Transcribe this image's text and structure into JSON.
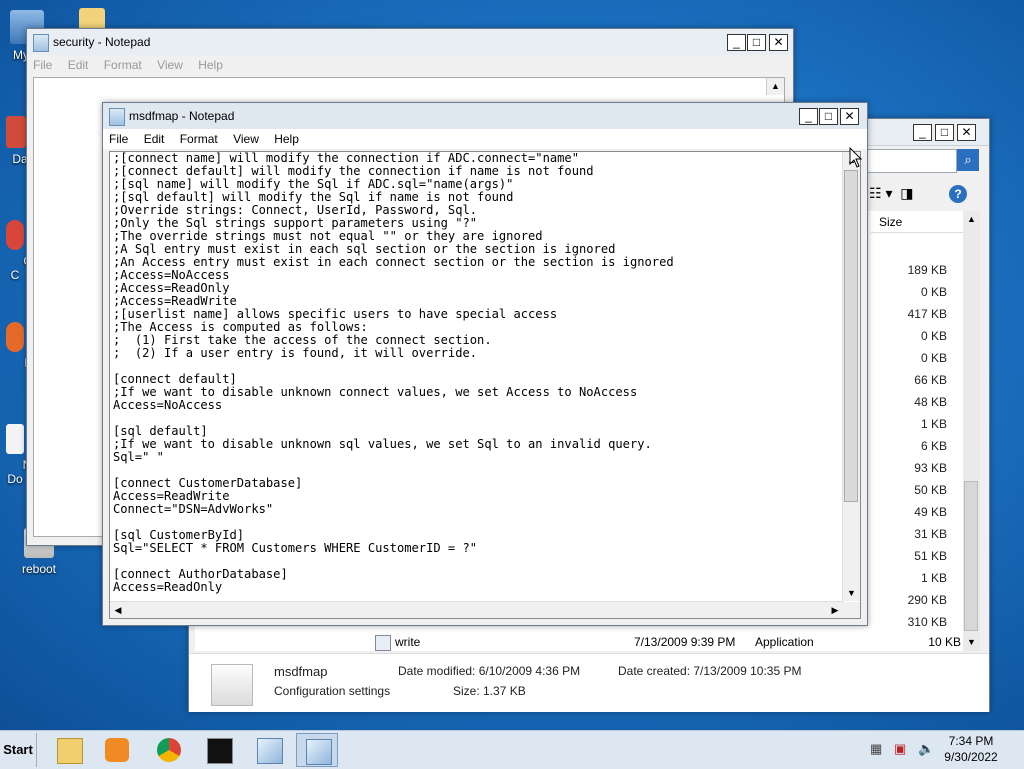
{
  "desktop": {
    "icons": [
      {
        "label": "My C",
        "name": "my-computer"
      },
      {
        "label": "Data",
        "name": "data-shortcut"
      },
      {
        "label": "G\nC",
        "name": "chrome-shortcut"
      },
      {
        "label": "F",
        "name": "firefox-shortcut"
      },
      {
        "label": "N\nDo",
        "name": "new-document"
      },
      {
        "label": "reboot",
        "name": "reboot"
      }
    ]
  },
  "security_window": {
    "title": "security - Notepad",
    "menu": [
      "File",
      "Edit",
      "Format",
      "View",
      "Help"
    ]
  },
  "explorer_window": {
    "column_size": "Size",
    "sizes": [
      "189 KB",
      "0 KB",
      "417 KB",
      "0 KB",
      "0 KB",
      "66 KB",
      "48 KB",
      "1 KB",
      "6 KB",
      "93 KB",
      "50 KB",
      "49 KB",
      "31 KB",
      "51 KB",
      "1 KB",
      "290 KB",
      "310 KB",
      "10 KB"
    ],
    "row_write": {
      "name": "write",
      "modified": "7/13/2009 9:39 PM",
      "type": "Application",
      "size": "10 KB"
    },
    "details": {
      "name": "msdfmap",
      "type": "Configuration settings",
      "modified": "Date modified: 6/10/2009 4:36 PM",
      "created": "Date created: 7/13/2009 10:35 PM",
      "size": "Size: 1.37 KB"
    }
  },
  "notepad": {
    "title": "msdfmap - Notepad",
    "menu": [
      "File",
      "Edit",
      "Format",
      "View",
      "Help"
    ],
    "lines": [
      ";[connect name] will modify the connection if ADC.connect=\"name\"",
      ";[connect default] will modify the connection if name is not found",
      ";[sql name] will modify the Sql if ADC.sql=\"name(args)\"",
      ";[sql default] will modify the Sql if name is not found",
      ";Override strings: Connect, UserId, Password, Sql.",
      ";Only the Sql strings support parameters using \"?\"",
      ";The override strings must not equal \"\" or they are ignored",
      ";A Sql entry must exist in each sql section or the section is ignored",
      ";An Access entry must exist in each connect section or the section is ignored",
      ";Access=NoAccess",
      ";Access=ReadOnly",
      ";Access=ReadWrite",
      ";[userlist name] allows specific users to have special access",
      ";The Access is computed as follows:",
      ";  (1) First take the access of the connect section.",
      ";  (2) If a user entry is found, it will override.",
      "",
      "[connect default]",
      ";If we want to disable unknown connect values, we set Access to NoAccess",
      "Access=NoAccess",
      "",
      "[sql default]",
      ";If we want to disable unknown sql values, we set Sql to an invalid query.",
      "Sql=\" \"",
      "",
      "[connect CustomerDatabase]",
      "Access=ReadWrite",
      "Connect=\"DSN=AdvWorks\"",
      "",
      "[sql CustomerById]",
      "Sql=\"SELECT * FROM Customers WHERE CustomerID = ?\"",
      "",
      "[connect AuthorDatabase]",
      "Access=ReadOnly"
    ]
  },
  "taskbar": {
    "start_label": "Start",
    "time": "7:34 PM",
    "date": "9/30/2022"
  }
}
